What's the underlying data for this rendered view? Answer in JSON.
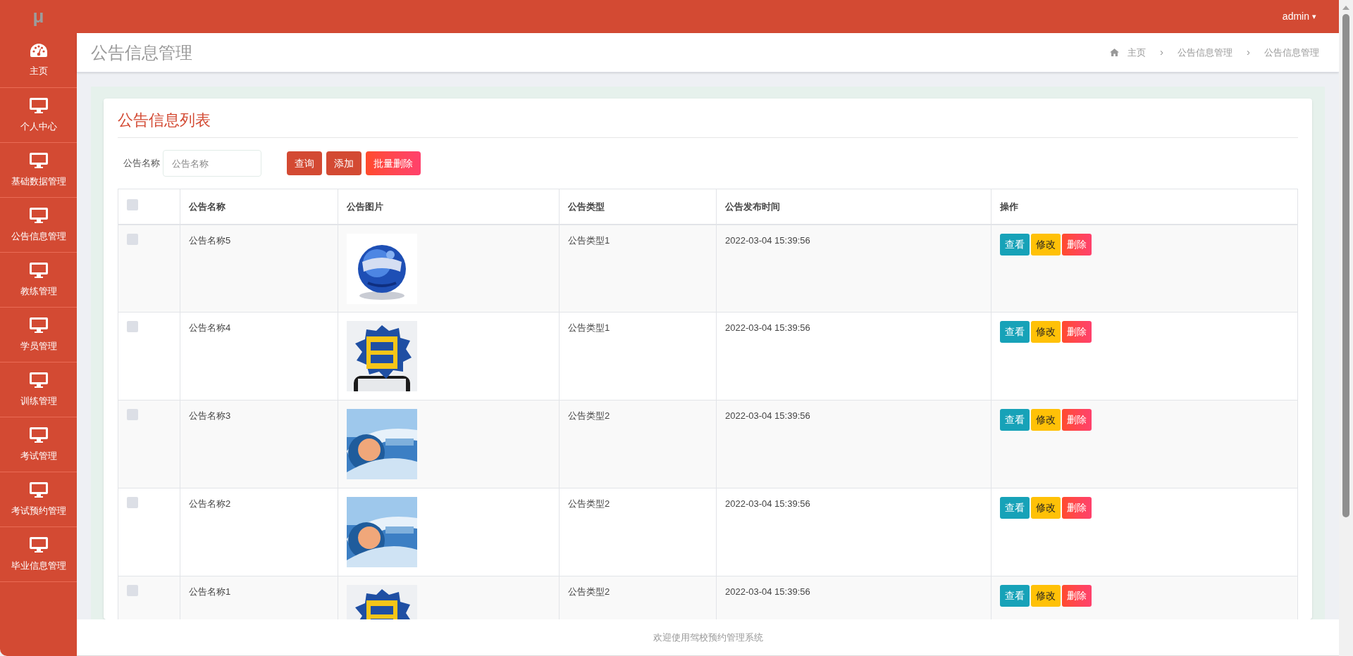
{
  "header": {
    "logo": "μ",
    "user": "admin",
    "caret": "▾"
  },
  "sidebar": {
    "items": [
      {
        "label": "主页",
        "kind": "gauge"
      },
      {
        "label": "个人中心",
        "kind": "monitor"
      },
      {
        "label": "基础数据管理",
        "kind": "monitor"
      },
      {
        "label": "公告信息管理",
        "kind": "monitor"
      },
      {
        "label": "教练管理",
        "kind": "monitor"
      },
      {
        "label": "学员管理",
        "kind": "monitor"
      },
      {
        "label": "训练管理",
        "kind": "monitor"
      },
      {
        "label": "考试管理",
        "kind": "monitor"
      },
      {
        "label": "考试预约管理",
        "kind": "monitor"
      },
      {
        "label": "毕业信息管理",
        "kind": "monitor"
      }
    ]
  },
  "page_title": "公告信息管理",
  "breadcrumb": [
    "主页",
    "公告信息管理",
    "公告信息管理"
  ],
  "breadcrumb_separator": "›",
  "card": {
    "title": "公告信息列表",
    "search": {
      "label": "公告名称",
      "placeholder": "公告名称"
    },
    "buttons": [
      {
        "label": "查询",
        "kind": "primary"
      },
      {
        "label": "添加",
        "kind": "primary"
      },
      {
        "label": "批量删除",
        "kind": "danger"
      }
    ]
  },
  "table": {
    "select_all": {
      "checked": false
    },
    "columns": [
      "公告名称",
      "公告图片",
      "公告类型",
      "公告发布时间",
      "操作"
    ],
    "rows": [
      {
        "checked": false,
        "name": "公告名称5",
        "type": "公告类型1",
        "time": "2022-03-04 15:39:56",
        "actions": [
          {
            "label": "查看",
            "kind": "view"
          },
          {
            "label": "修改",
            "kind": "edit"
          },
          {
            "label": "删除",
            "kind": "delete"
          }
        ]
      },
      {
        "checked": false,
        "name": "公告名称4",
        "type": "公告类型1",
        "time": "2022-03-04 15:39:56",
        "actions": [
          {
            "label": "查看",
            "kind": "view"
          },
          {
            "label": "修改",
            "kind": "edit"
          },
          {
            "label": "删除",
            "kind": "delete"
          }
        ]
      },
      {
        "checked": false,
        "name": "公告名称3",
        "type": "公告类型2",
        "time": "2022-03-04 15:39:56",
        "actions": [
          {
            "label": "查看",
            "kind": "view"
          },
          {
            "label": "修改",
            "kind": "edit"
          },
          {
            "label": "删除",
            "kind": "delete"
          }
        ]
      },
      {
        "checked": false,
        "name": "公告名称2",
        "type": "公告类型2",
        "time": "2022-03-04 15:39:56",
        "actions": [
          {
            "label": "查看",
            "kind": "view"
          },
          {
            "label": "修改",
            "kind": "edit"
          },
          {
            "label": "删除",
            "kind": "delete"
          }
        ]
      },
      {
        "checked": false,
        "name": "公告名称1",
        "type": "公告类型2",
        "time": "2022-03-04 15:39:56",
        "actions": [
          {
            "label": "查看",
            "kind": "view"
          },
          {
            "label": "修改",
            "kind": "edit"
          },
          {
            "label": "删除",
            "kind": "delete"
          }
        ]
      }
    ]
  },
  "footer": "欢迎使用驾校预约管理系统"
}
